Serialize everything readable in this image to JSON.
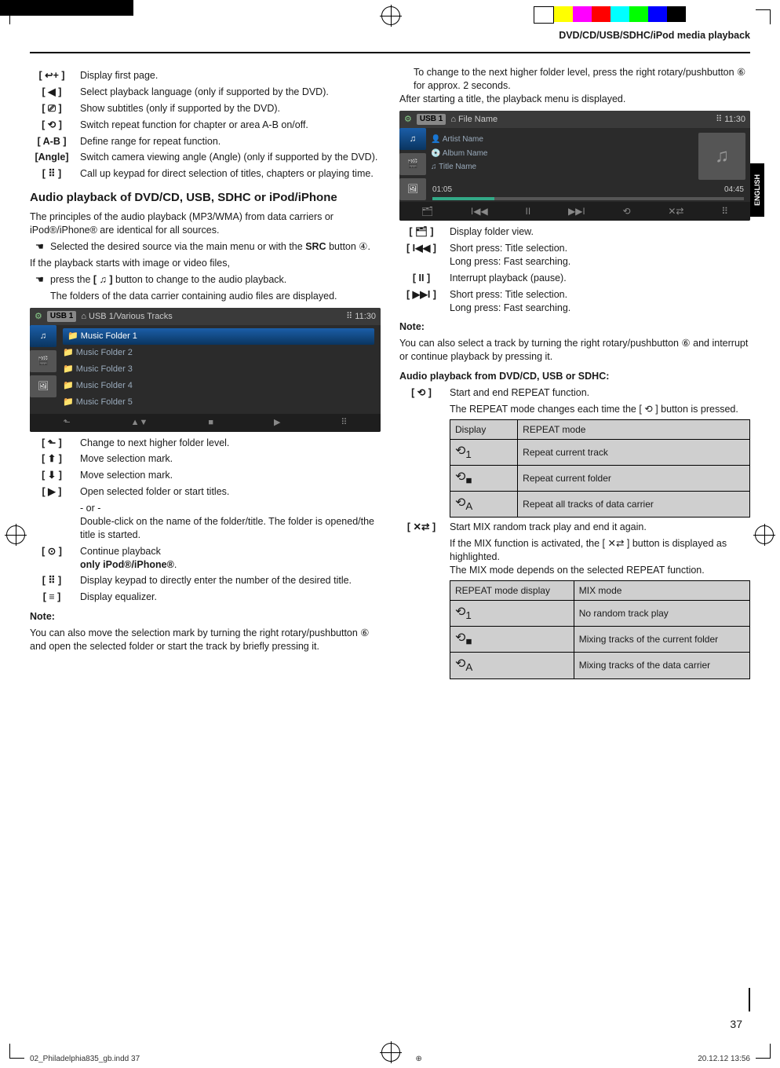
{
  "header": {
    "section": "DVD/CD/USB/SDHC/iPod media playback"
  },
  "lang_tab": "ENGLISH",
  "left": {
    "items1": [
      {
        "icon": "↩+",
        "text": "Display first page."
      },
      {
        "icon": "◀🔊",
        "text": "Select playback language (only if supported by the DVD)."
      },
      {
        "icon": "⎚",
        "text": "Show subtitles (only if supported by the DVD)."
      },
      {
        "icon": "⟲",
        "text": "Switch repeat function for chapter or area A-B on/off."
      },
      {
        "icon": "A-B",
        "text": "Define range for repeat function."
      },
      {
        "icon": "Angle",
        "text": "Switch camera viewing angle (Angle) (only if supported by the DVD)."
      },
      {
        "icon": "⠿",
        "text": "Call up keypad for direct selection of titles, chapters or playing time."
      }
    ],
    "heading": "Audio playback of DVD/CD, USB, SDHC or iPod/iPhone",
    "para1": "The principles of the audio playback (MP3/WMA) from data carriers or iPod®/iPhone® are identical for all sources.",
    "bullet1": "Selected the desired source via the main menu or with the SRC button ④.",
    "para2": "If the playback starts with image or video files,",
    "bullet2": "press the [ ♫ ] button to change to the audio playback.",
    "para3": "The folders of the data carrier containing audio files are displayed.",
    "ss1": {
      "badge": "USB 1",
      "path": "⌂ USB 1/Various Tracks",
      "time": "⠿ 11:30",
      "folders": [
        "Music Folder 1",
        "Music Folder 2",
        "Music Folder 3",
        "Music Folder 4",
        "Music Folder 5"
      ]
    },
    "items2": [
      {
        "icon": "⬑",
        "text": "Change to next higher folder level."
      },
      {
        "icon": "⬆",
        "text": "Move selection mark."
      },
      {
        "icon": "⬇",
        "text": "Move selection mark."
      },
      {
        "icon": "▶",
        "text": "Open selected folder or start titles."
      }
    ],
    "or": "- or -",
    "dbl": "Double-click on the name of the folder/title. The folder is opened/the title is started.",
    "items3": [
      {
        "icon": "⊙▶",
        "text": "Continue playback",
        "bold": "only iPod®/iPhone®"
      },
      {
        "icon": "⠿",
        "text": "Display keypad to directly enter the number of the desired title."
      },
      {
        "icon": "≡",
        "text": "Display equalizer."
      }
    ],
    "note_h": "Note:",
    "note": "You can also move the selection mark by turning the right rotary/pushbutton ⑥ and open the selected folder or start the track by briefly pressing it. To change to the next higher folder level, press the right rotary/pushbutton ⑥ for approx. 2 seconds."
  },
  "right": {
    "note_cont": "To change to the next higher folder level, press the right rotary/pushbutton ⑥ for approx. 2 seconds.",
    "after": "After starting a title, the playback menu is displayed.",
    "ss2": {
      "badge": "USB 1",
      "path": "⌂ File Name",
      "time": "⠿ 11:30",
      "artist": "Artist Name",
      "album": "Album Name",
      "title": "Title Name",
      "t1": "01:05",
      "t2": "04:45"
    },
    "items": [
      {
        "icon": "🗂",
        "text": "Display folder view."
      },
      {
        "icon": "I◀◀",
        "text": "Short press: Title selection.",
        "line2": "Long press: Fast searching."
      },
      {
        "icon": "II",
        "text": "Interrupt playback (pause)."
      },
      {
        "icon": "▶▶I",
        "text": "Short press: Title selection.",
        "line2": "Long press: Fast searching."
      }
    ],
    "note_h": "Note:",
    "note": "You can also select a track by turning the right rotary/pushbutton ⑥ and interrupt or continue playback by pressing it.",
    "sub1": "Audio playback from DVD/CD, USB or SDHC:",
    "repeat_item": {
      "icon": "⟲",
      "text": "Start and end REPEAT function."
    },
    "repeat_p": "The REPEAT mode changes each time the [ ⟲ ] button is pressed.",
    "table1": {
      "head": [
        "Display",
        "REPEAT mode"
      ],
      "rows": [
        [
          "⟲₁",
          "Repeat current track"
        ],
        [
          "⟲■",
          "Repeat current folder"
        ],
        [
          "⟲ₐ",
          "Repeat all tracks of data carrier"
        ]
      ]
    },
    "mix_item": {
      "icon": "✕⇄",
      "text": "Start MIX random track play and end it again."
    },
    "mix_p1": "If the MIX function is activated, the [ ✕⇄ ] button is displayed as highlighted.",
    "mix_p2": "The MIX mode depends on the selected REPEAT function.",
    "table2": {
      "head": [
        "REPEAT mode display",
        "MIX mode"
      ],
      "rows": [
        [
          "⟲₁",
          "No random track play"
        ],
        [
          "⟲■",
          "Mixing tracks of the current folder"
        ],
        [
          "⟲ₐ",
          "Mixing tracks of the data carrier"
        ]
      ]
    }
  },
  "pagenum": "37",
  "footer": {
    "file": "02_Philadelphia835_gb.indd   37",
    "date": "20.12.12   13:56"
  }
}
